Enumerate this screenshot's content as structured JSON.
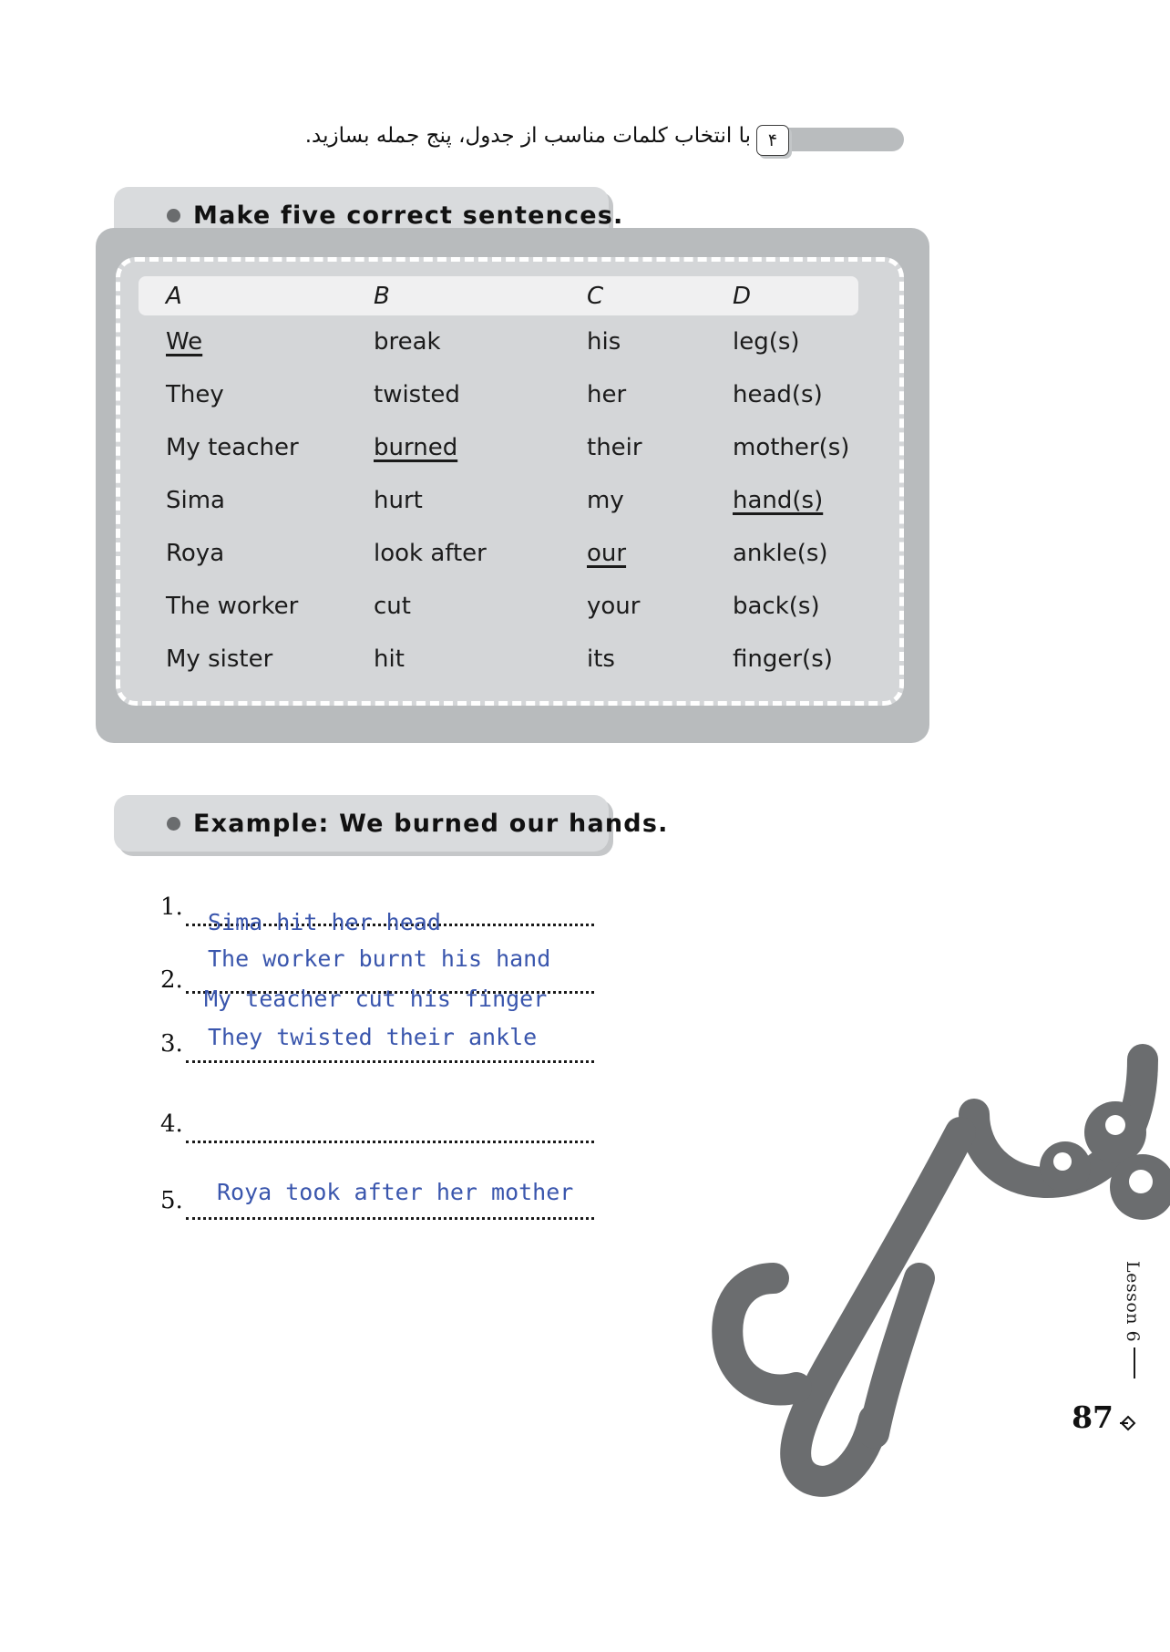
{
  "task": {
    "number": "۴",
    "instruction_fa": "با انتخاب کلمات مناسب از جدول، پنج جمله بسازید."
  },
  "instruction_pill": {
    "text": "Make  five  correct  sentences."
  },
  "example_pill": {
    "text": "Example:  We  burned  our  hands."
  },
  "table": {
    "headers": [
      "A",
      "B",
      "C",
      "D"
    ],
    "rows": [
      {
        "a": "We",
        "b": "break",
        "c": "his",
        "d": "leg(s)",
        "underline": [
          "a"
        ]
      },
      {
        "a": "They",
        "b": "twisted",
        "c": "her",
        "d": "head(s)",
        "underline": []
      },
      {
        "a": "My teacher",
        "b": "burned",
        "c": "their",
        "d": "mother(s)",
        "underline": [
          "b"
        ]
      },
      {
        "a": "Sima",
        "b": "hurt",
        "c": "my",
        "d": "hand(s)",
        "underline": [
          "d"
        ]
      },
      {
        "a": "Roya",
        "b": "look after",
        "c": "our",
        "d": "ankle(s)",
        "underline": [
          "c"
        ]
      },
      {
        "a": "The worker",
        "b": "cut",
        "c": "your",
        "d": "back(s)",
        "underline": []
      },
      {
        "a": "My sister",
        "b": "hit",
        "c": "its",
        "d": "finger(s)",
        "underline": []
      }
    ]
  },
  "answers": [
    {
      "num": "1.",
      "text": "Sima hit her head"
    },
    {
      "num": "2.",
      "text": "The worker burnt his hand"
    },
    {
      "num": "",
      "text": "My teacher cut his finger"
    },
    {
      "num": "3.",
      "text": "They twisted their ankle"
    },
    {
      "num": "4.",
      "text": ""
    },
    {
      "num": "5.",
      "text": "Roya took after her mother"
    }
  ],
  "footer": {
    "lesson": "Lesson 6",
    "page_number": "87"
  },
  "colors": {
    "handwriting": "#3a56ad",
    "panel": "#d9dbdd",
    "card": "#d4d6d8",
    "shadow": "#b8bbbd",
    "watermark": "#6b6d6f"
  }
}
